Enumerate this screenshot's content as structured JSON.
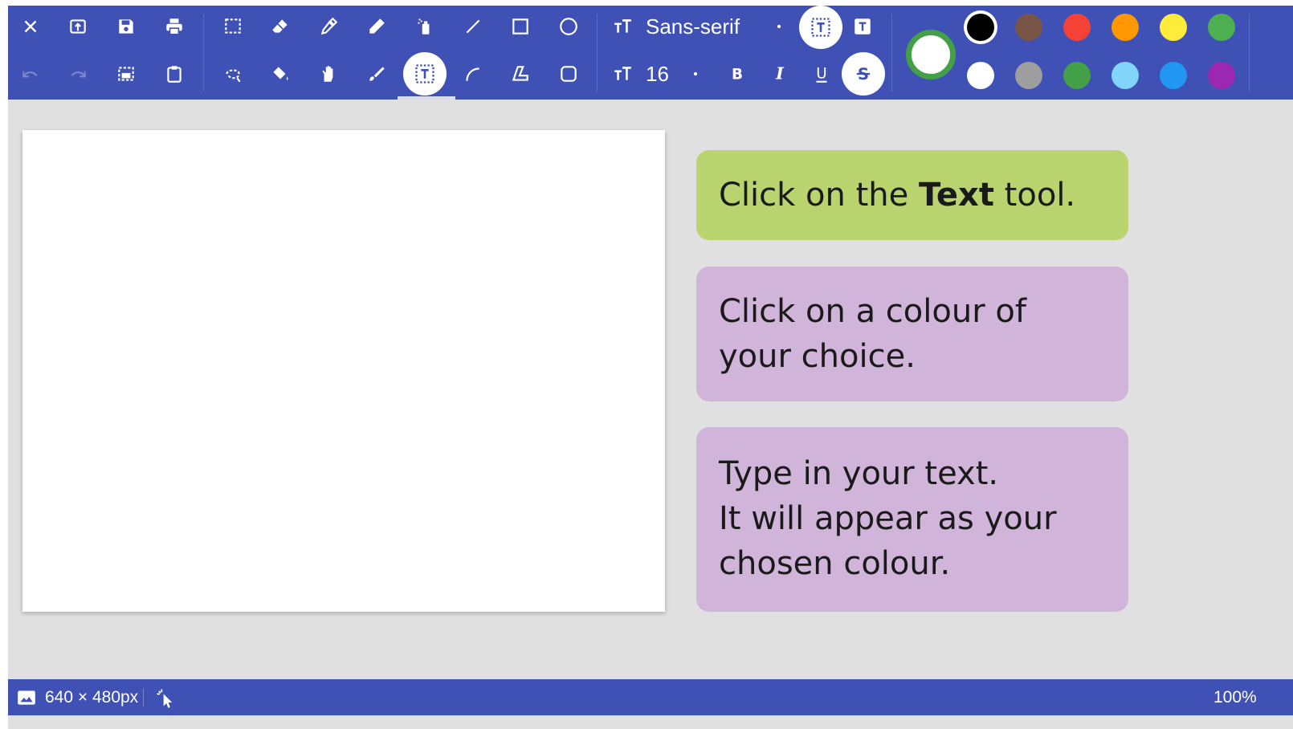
{
  "toolbar": {
    "font_family": "Sans-serif",
    "font_size": "16",
    "tools_row1": [
      "close-icon",
      "open-icon",
      "save-icon",
      "print-icon",
      "rect-select-icon",
      "eraser-icon",
      "color-picker-icon",
      "pencil-icon",
      "spray-icon",
      "line-icon",
      "rectangle-icon",
      "ellipse-icon"
    ],
    "tools_row2": [
      "undo-icon",
      "redo-icon",
      "image-select-icon",
      "clipboard-icon",
      "lasso-select-icon",
      "fill-icon",
      "hand-icon",
      "brush-icon",
      "text-icon",
      "curve-icon",
      "polygon-icon",
      "rounded-rect-icon"
    ],
    "active_tool": "text-icon",
    "text_styles": [
      "B",
      "I",
      "U",
      "S"
    ],
    "current_color": "#ffffff",
    "palette_row1": [
      "#000000",
      "#795548",
      "#f44336",
      "#ff9800",
      "#ffeb3b",
      "#4caf50"
    ],
    "palette_row2": [
      "#ffffff",
      "#9e9e9e",
      "#43a047",
      "#81d4fa",
      "#2196f3",
      "#9c27b0"
    ]
  },
  "cards": {
    "step1_before": "Click on the ",
    "step1_bold": "Text",
    "step1_after": " tool.",
    "step2": "Click on a colour of your choice.",
    "step3_line1": "Type in your text.",
    "step3_line2": "It will appear as your chosen colour."
  },
  "status": {
    "canvas_size": "640 × 480px",
    "zoom": "100%"
  },
  "colors": {
    "toolbar_bg": "#3f51b5",
    "card_green": "#b9d46e",
    "card_purple": "#d1b4d9"
  }
}
